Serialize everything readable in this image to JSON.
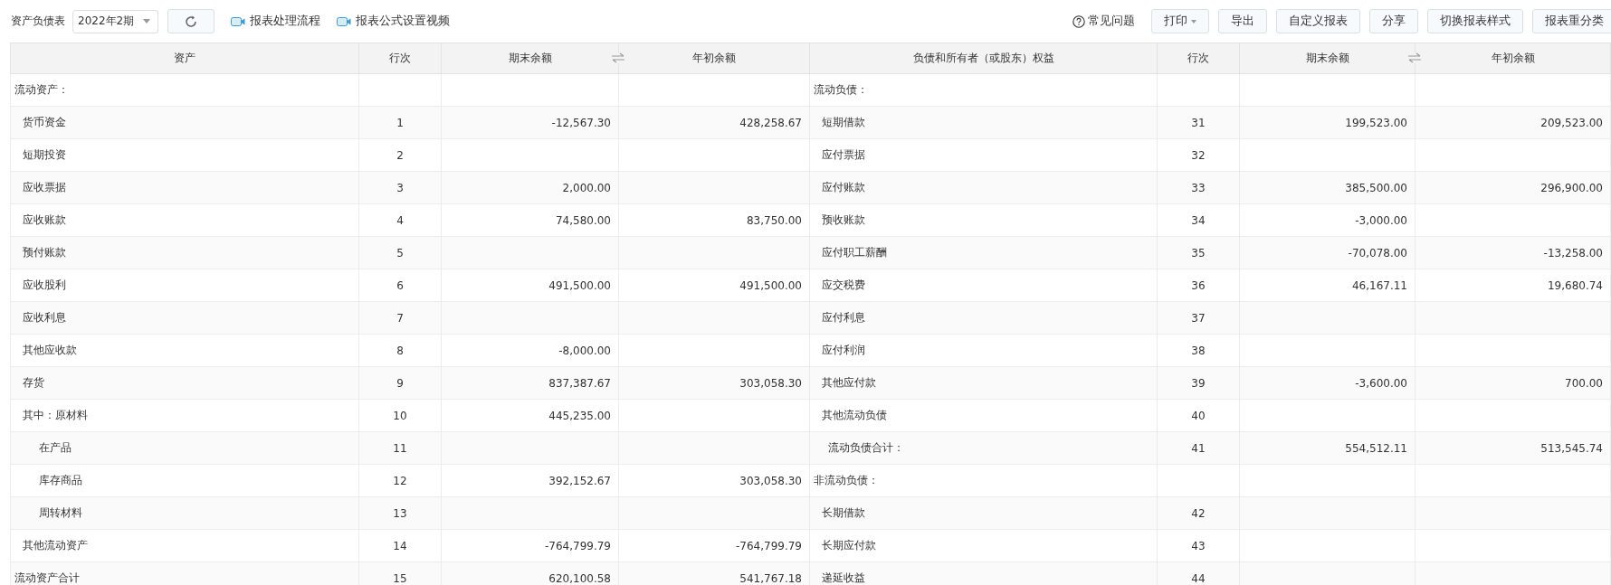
{
  "toolbar": {
    "report_label": "资产负债表",
    "period_select": {
      "value": "2022年2期"
    },
    "links": [
      "报表处理流程",
      "报表公式设置视频"
    ],
    "help_link": "常见问题",
    "buttons": [
      {
        "label": "打印",
        "dropdown": true
      },
      {
        "label": "导出",
        "dropdown": false
      },
      {
        "label": "自定义报表",
        "dropdown": false
      },
      {
        "label": "分享",
        "dropdown": false
      },
      {
        "label": "切换报表样式",
        "dropdown": false
      },
      {
        "label": "报表重分类",
        "dropdown": false
      }
    ]
  },
  "table": {
    "columns": [
      "资产",
      "行次",
      "期末余额",
      "年初余额",
      "负债和所有者（或股东）权益",
      "行次",
      "期末余额",
      "年初余额"
    ],
    "rows": [
      {
        "left": {
          "kind": "section",
          "name": "流动资产："
        },
        "right": {
          "kind": "section",
          "name": "流动负债："
        }
      },
      {
        "left": {
          "kind": "item",
          "name": "货币资金",
          "line": "1",
          "end": "-12,567.30",
          "begin": "428,258.67"
        },
        "right": {
          "kind": "item",
          "name": "短期借款",
          "line": "31",
          "end": "199,523.00",
          "begin": "209,523.00"
        }
      },
      {
        "left": {
          "kind": "item",
          "name": "短期投资",
          "line": "2"
        },
        "right": {
          "kind": "item",
          "name": "应付票据",
          "line": "32"
        }
      },
      {
        "left": {
          "kind": "item",
          "name": "应收票据",
          "line": "3",
          "end": "2,000.00"
        },
        "right": {
          "kind": "item",
          "name": "应付账款",
          "line": "33",
          "end": "385,500.00",
          "begin": "296,900.00"
        }
      },
      {
        "left": {
          "kind": "item",
          "name": "应收账款",
          "line": "4",
          "end": "74,580.00",
          "begin": "83,750.00"
        },
        "right": {
          "kind": "item",
          "name": "预收账款",
          "line": "34",
          "end": "-3,000.00"
        }
      },
      {
        "left": {
          "kind": "item",
          "name": "预付账款",
          "line": "5"
        },
        "right": {
          "kind": "item",
          "name": "应付职工薪酬",
          "line": "35",
          "end": "-70,078.00",
          "begin": "-13,258.00"
        }
      },
      {
        "left": {
          "kind": "item",
          "name": "应收股利",
          "line": "6",
          "end": "491,500.00",
          "begin": "491,500.00"
        },
        "right": {
          "kind": "item",
          "name": "应交税费",
          "line": "36",
          "end": "46,167.11",
          "begin": "19,680.74"
        }
      },
      {
        "left": {
          "kind": "item",
          "name": "应收利息",
          "line": "7"
        },
        "right": {
          "kind": "item",
          "name": "应付利息",
          "line": "37"
        }
      },
      {
        "left": {
          "kind": "item",
          "name": "其他应收款",
          "line": "8",
          "end": "-8,000.00"
        },
        "right": {
          "kind": "item",
          "name": "应付利润",
          "line": "38"
        }
      },
      {
        "left": {
          "kind": "item",
          "name": "存货",
          "line": "9",
          "end": "837,387.67",
          "begin": "303,058.30"
        },
        "right": {
          "kind": "item",
          "name": "其他应付款",
          "line": "39",
          "end": "-3,600.00",
          "begin": "700.00"
        }
      },
      {
        "left": {
          "kind": "item",
          "name": "其中：原材料",
          "line": "10",
          "end": "445,235.00"
        },
        "right": {
          "kind": "item",
          "name": "其他流动负债",
          "line": "40"
        }
      },
      {
        "left": {
          "kind": "sub",
          "name": "在产品",
          "line": "11"
        },
        "right": {
          "kind": "subtotal",
          "name": "流动负债合计：",
          "line": "41",
          "end": "554,512.11",
          "begin": "513,545.74"
        }
      },
      {
        "left": {
          "kind": "sub",
          "name": "库存商品",
          "line": "12",
          "end": "392,152.67",
          "begin": "303,058.30"
        },
        "right": {
          "kind": "section",
          "name": "非流动负债："
        }
      },
      {
        "left": {
          "kind": "sub",
          "name": "周转材料",
          "line": "13"
        },
        "right": {
          "kind": "item",
          "name": "长期借款",
          "line": "42"
        }
      },
      {
        "left": {
          "kind": "item",
          "name": "其他流动资产",
          "line": "14",
          "end": "-764,799.79",
          "begin": "-764,799.79"
        },
        "right": {
          "kind": "item",
          "name": "长期应付款",
          "line": "43"
        }
      },
      {
        "left": {
          "kind": "section",
          "name": "流动资产合计",
          "line": "15",
          "end": "620,100.58",
          "begin": "541,767.18"
        },
        "right": {
          "kind": "item",
          "name": "递延收益",
          "line": "44"
        }
      }
    ]
  }
}
